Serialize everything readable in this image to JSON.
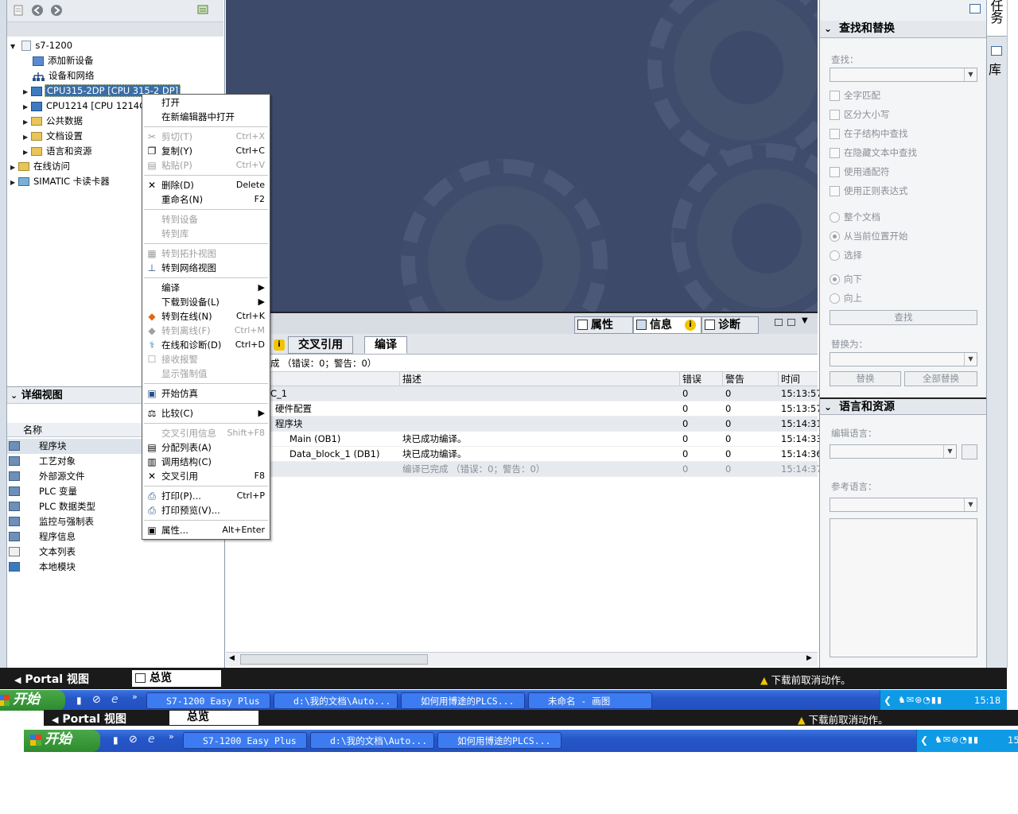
{
  "project_tree": {
    "root": "s7-1200",
    "items": [
      {
        "label": "添加新设备"
      },
      {
        "label": "设备和网络"
      },
      {
        "label": "CPU315-2DP [CPU 315-2 DP]"
      },
      {
        "label": "CPU1214 [CPU 1214C"
      },
      {
        "label": "公共数据"
      },
      {
        "label": "文档设置"
      },
      {
        "label": "语言和资源"
      },
      {
        "label": "在线访问"
      },
      {
        "label": "SIMATIC 卡读卡器"
      }
    ]
  },
  "detail_view": {
    "title": "详细视图",
    "column": "名称",
    "items": [
      "程序块",
      "工艺对象",
      "外部源文件",
      "PLC 变量",
      "PLC 数据类型",
      "监控与强制表",
      "程序信息",
      "文本列表",
      "本地模块"
    ]
  },
  "context_menu": {
    "items": [
      {
        "label": "打开",
        "shortcut": ""
      },
      {
        "label": "在新编辑器中打开",
        "shortcut": ""
      },
      {
        "label": "剪切(T)",
        "shortcut": "Ctrl+X"
      },
      {
        "label": "复制(Y)",
        "shortcut": "Ctrl+C"
      },
      {
        "label": "粘贴(P)",
        "shortcut": "Ctrl+V"
      },
      {
        "label": "删除(D)",
        "shortcut": "Delete"
      },
      {
        "label": "重命名(N)",
        "shortcut": "F2"
      },
      {
        "label": "转到设备",
        "shortcut": ""
      },
      {
        "label": "转到库",
        "shortcut": ""
      },
      {
        "label": "转到拓扑视图",
        "shortcut": ""
      },
      {
        "label": "转到网络视图",
        "shortcut": ""
      },
      {
        "label": "编译",
        "shortcut": ""
      },
      {
        "label": "下载到设备(L)",
        "shortcut": ""
      },
      {
        "label": "转到在线(N)",
        "shortcut": "Ctrl+K"
      },
      {
        "label": "转到离线(F)",
        "shortcut": "Ctrl+M"
      },
      {
        "label": "在线和诊断(D)",
        "shortcut": "Ctrl+D"
      },
      {
        "label": "接收报警",
        "shortcut": ""
      },
      {
        "label": "显示强制值",
        "shortcut": ""
      },
      {
        "label": "开始仿真",
        "shortcut": ""
      },
      {
        "label": "比较(C)",
        "shortcut": ""
      },
      {
        "label": "交叉引用信息",
        "shortcut": "Shift+F8"
      },
      {
        "label": "分配列表(A)",
        "shortcut": ""
      },
      {
        "label": "调用结构(C)",
        "shortcut": ""
      },
      {
        "label": "交叉引用",
        "shortcut": "F8"
      },
      {
        "label": "打印(P)...",
        "shortcut": "Ctrl+P"
      },
      {
        "label": "打印预览(V)...",
        "shortcut": ""
      },
      {
        "label": "属性...",
        "shortcut": "Alt+Enter"
      }
    ]
  },
  "inspector": {
    "tabs": [
      "属性",
      "信息",
      "诊断"
    ]
  },
  "info_tabs": [
    "交叉引用",
    "编译"
  ],
  "compile": {
    "status": "成 （错误：0；警告：0）",
    "columns": [
      "描述",
      "错误",
      "警告",
      "时间"
    ],
    "rows": [
      {
        "name": "C_1",
        "desc": "",
        "err": "0",
        "warn": "0",
        "time": "15:13:57"
      },
      {
        "name": "硬件配置",
        "desc": "",
        "err": "0",
        "warn": "0",
        "time": "15:13:57"
      },
      {
        "name": "程序块",
        "desc": "",
        "err": "0",
        "warn": "0",
        "time": "15:14:31"
      },
      {
        "name": "Main (OB1)",
        "desc": "块已成功编译。",
        "err": "0",
        "warn": "0",
        "time": "15:14:33"
      },
      {
        "name": "Data_block_1 (DB1)",
        "desc": "块已成功编译。",
        "err": "0",
        "warn": "0",
        "time": "15:14:36"
      },
      {
        "name": "",
        "desc": "编译已完成 （错误：0；警告：0）",
        "err": "0",
        "warn": "0",
        "time": "15:14:37"
      }
    ]
  },
  "task_panel": {
    "side_tabs": [
      "任务",
      "库"
    ],
    "find_replace": {
      "title": "查找和替换",
      "find_label": "查找：",
      "checks": [
        "全字匹配",
        "区分大小写",
        "在子结构中查找",
        "在隐藏文本中查找",
        "使用通配符",
        "使用正则表达式"
      ],
      "scope": [
        "整个文档",
        "从当前位置开始",
        "选择"
      ],
      "direction": [
        "向下",
        "向上"
      ],
      "find_button": "查找",
      "replace_label": "替换为：",
      "replace_button": "替换",
      "replace_all_button": "全部替换"
    },
    "language": {
      "title": "语言和资源",
      "edit_lang_label": "编辑语言：",
      "ref_lang_label": "参考语言："
    }
  },
  "status_bar": {
    "portal": "Portal 视图",
    "overview": "总览",
    "message": "下载前取消动作。"
  },
  "taskbar": {
    "start": "开始",
    "items": [
      "S7-1200 Easy Plus",
      "d:\\我的文档\\Auto...",
      "如何用博途的PLCS...",
      "未命名 - 画图"
    ],
    "clock": "15:18"
  },
  "taskbar2": {
    "start": "开始",
    "items": [
      "S7-1200 Easy Plus",
      "d:\\我的文档\\Auto...",
      "如何用博途的PLCS..."
    ],
    "clock": "15"
  },
  "colors": {
    "selection": "#3a6ea5",
    "editor_bg": "#3d4a6a",
    "taskbar": "#2656c8",
    "start": "#2e8a2e"
  }
}
